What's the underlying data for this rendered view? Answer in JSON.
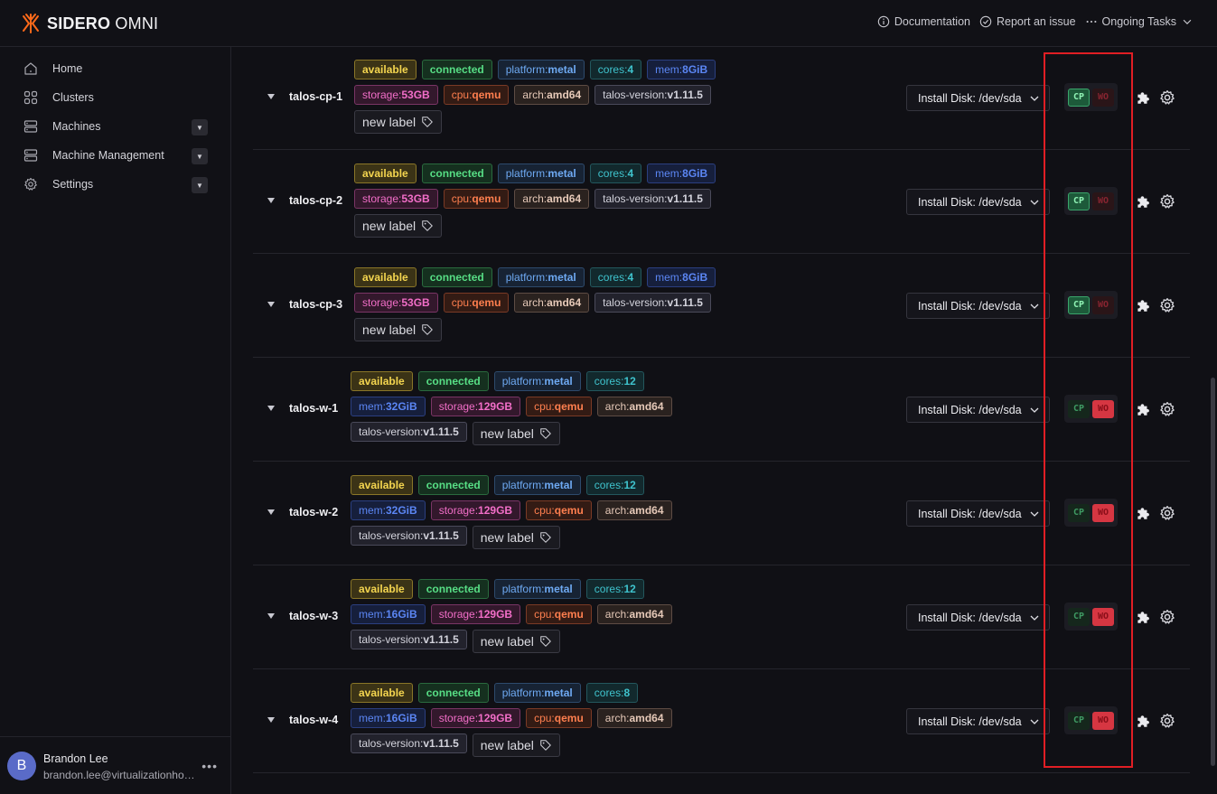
{
  "brand": {
    "name_bold": "SIDERO",
    "name_thin": "OMNI",
    "accent": "#ff6a1a"
  },
  "topbar": {
    "documentation": "Documentation",
    "report_issue": "Report an issue",
    "ongoing_tasks": "Ongoing Tasks"
  },
  "sidebar": {
    "items": [
      {
        "label": "Home",
        "icon": "home-icon"
      },
      {
        "label": "Clusters",
        "icon": "clusters-icon"
      },
      {
        "label": "Machines",
        "icon": "server-icon"
      },
      {
        "label": "Machine Management",
        "icon": "server-icon"
      },
      {
        "label": "Settings",
        "icon": "gear-icon"
      }
    ]
  },
  "user": {
    "initial": "B",
    "name": "Brandon Lee",
    "email": "brandon.lee@virtualizationho…"
  },
  "machines": [
    {
      "name": "talos-cp-1",
      "labels": [
        {
          "k": "available",
          "v": ""
        },
        {
          "k": "connected",
          "v": ""
        },
        {
          "k": "platform:",
          "v": "metal"
        },
        {
          "k": "cores:",
          "v": "4"
        },
        {
          "k": "mem:",
          "v": "8GiB"
        },
        {
          "k": "storage:",
          "v": "53GB"
        },
        {
          "k": "cpu:",
          "v": "qemu"
        },
        {
          "k": "arch:",
          "v": "amd64"
        },
        {
          "k": "talos-version:",
          "v": "v1.11.5"
        }
      ],
      "new_label": "new label",
      "install_disk": "Install Disk: /dev/sda",
      "role_cp": "CP",
      "role_wo": "WO",
      "role": "cp"
    },
    {
      "name": "talos-cp-2",
      "labels": [
        {
          "k": "available",
          "v": ""
        },
        {
          "k": "connected",
          "v": ""
        },
        {
          "k": "platform:",
          "v": "metal"
        },
        {
          "k": "cores:",
          "v": "4"
        },
        {
          "k": "mem:",
          "v": "8GiB"
        },
        {
          "k": "storage:",
          "v": "53GB"
        },
        {
          "k": "cpu:",
          "v": "qemu"
        },
        {
          "k": "arch:",
          "v": "amd64"
        },
        {
          "k": "talos-version:",
          "v": "v1.11.5"
        }
      ],
      "new_label": "new label",
      "install_disk": "Install Disk: /dev/sda",
      "role_cp": "CP",
      "role_wo": "WO",
      "role": "cp"
    },
    {
      "name": "talos-cp-3",
      "labels": [
        {
          "k": "available",
          "v": ""
        },
        {
          "k": "connected",
          "v": ""
        },
        {
          "k": "platform:",
          "v": "metal"
        },
        {
          "k": "cores:",
          "v": "4"
        },
        {
          "k": "mem:",
          "v": "8GiB"
        },
        {
          "k": "storage:",
          "v": "53GB"
        },
        {
          "k": "cpu:",
          "v": "qemu"
        },
        {
          "k": "arch:",
          "v": "amd64"
        },
        {
          "k": "talos-version:",
          "v": "v1.11.5"
        }
      ],
      "new_label": "new label",
      "install_disk": "Install Disk: /dev/sda",
      "role_cp": "CP",
      "role_wo": "WO",
      "role": "cp"
    },
    {
      "name": "talos-w-1",
      "labels": [
        {
          "k": "available",
          "v": ""
        },
        {
          "k": "connected",
          "v": ""
        },
        {
          "k": "platform:",
          "v": "metal"
        },
        {
          "k": "cores:",
          "v": "12"
        },
        {
          "k": "mem:",
          "v": "32GiB"
        },
        {
          "k": "storage:",
          "v": "129GB"
        },
        {
          "k": "cpu:",
          "v": "qemu"
        },
        {
          "k": "arch:",
          "v": "amd64"
        },
        {
          "k": "talos-version:",
          "v": "v1.11.5"
        }
      ],
      "new_label": "new label",
      "install_disk": "Install Disk: /dev/sda",
      "role_cp": "CP",
      "role_wo": "WO",
      "role": "wo"
    },
    {
      "name": "talos-w-2",
      "labels": [
        {
          "k": "available",
          "v": ""
        },
        {
          "k": "connected",
          "v": ""
        },
        {
          "k": "platform:",
          "v": "metal"
        },
        {
          "k": "cores:",
          "v": "12"
        },
        {
          "k": "mem:",
          "v": "32GiB"
        },
        {
          "k": "storage:",
          "v": "129GB"
        },
        {
          "k": "cpu:",
          "v": "qemu"
        },
        {
          "k": "arch:",
          "v": "amd64"
        },
        {
          "k": "talos-version:",
          "v": "v1.11.5"
        }
      ],
      "new_label": "new label",
      "install_disk": "Install Disk: /dev/sda",
      "role_cp": "CP",
      "role_wo": "WO",
      "role": "wo"
    },
    {
      "name": "talos-w-3",
      "labels": [
        {
          "k": "available",
          "v": ""
        },
        {
          "k": "connected",
          "v": ""
        },
        {
          "k": "platform:",
          "v": "metal"
        },
        {
          "k": "cores:",
          "v": "12"
        },
        {
          "k": "mem:",
          "v": "16GiB"
        },
        {
          "k": "storage:",
          "v": "129GB"
        },
        {
          "k": "cpu:",
          "v": "qemu"
        },
        {
          "k": "arch:",
          "v": "amd64"
        },
        {
          "k": "talos-version:",
          "v": "v1.11.5"
        }
      ],
      "new_label": "new label",
      "install_disk": "Install Disk: /dev/sda",
      "role_cp": "CP",
      "role_wo": "WO",
      "role": "wo"
    },
    {
      "name": "talos-w-4",
      "labels": [
        {
          "k": "available",
          "v": ""
        },
        {
          "k": "connected",
          "v": ""
        },
        {
          "k": "platform:",
          "v": "metal"
        },
        {
          "k": "cores:",
          "v": "8"
        },
        {
          "k": "mem:",
          "v": "16GiB"
        },
        {
          "k": "storage:",
          "v": "129GB"
        },
        {
          "k": "cpu:",
          "v": "qemu"
        },
        {
          "k": "arch:",
          "v": "amd64"
        },
        {
          "k": "talos-version:",
          "v": "v1.11.5"
        }
      ],
      "new_label": "new label",
      "install_disk": "Install Disk: /dev/sda",
      "role_cp": "CP",
      "role_wo": "WO",
      "role": "wo"
    }
  ],
  "colors": {
    "highlight": "#e01e24"
  }
}
